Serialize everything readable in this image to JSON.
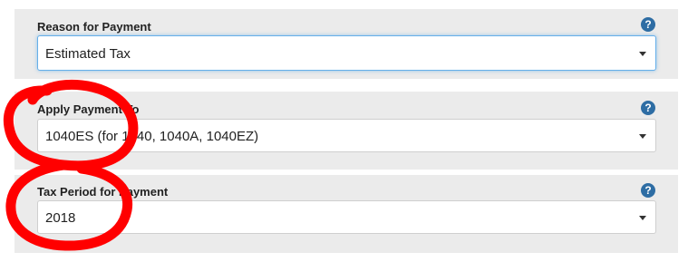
{
  "reason_field": {
    "label": "Reason for Payment",
    "value": "Estimated Tax",
    "help_glyph": "?",
    "help_icon": "question-circle-icon"
  },
  "apply_field": {
    "label": "Apply Payment To",
    "value": "1040ES (for 1040, 1040A, 1040EZ)",
    "help_glyph": "?",
    "help_icon": "question-circle-icon"
  },
  "period_field": {
    "label": "Tax Period for Payment",
    "value": "2018",
    "help_glyph": "?",
    "help_icon": "question-circle-icon"
  },
  "colors": {
    "panel_bg": "#ebebeb",
    "help_icon": "#2e6da4",
    "focus_border": "#66afe9",
    "annotation_red": "#ff0000"
  }
}
